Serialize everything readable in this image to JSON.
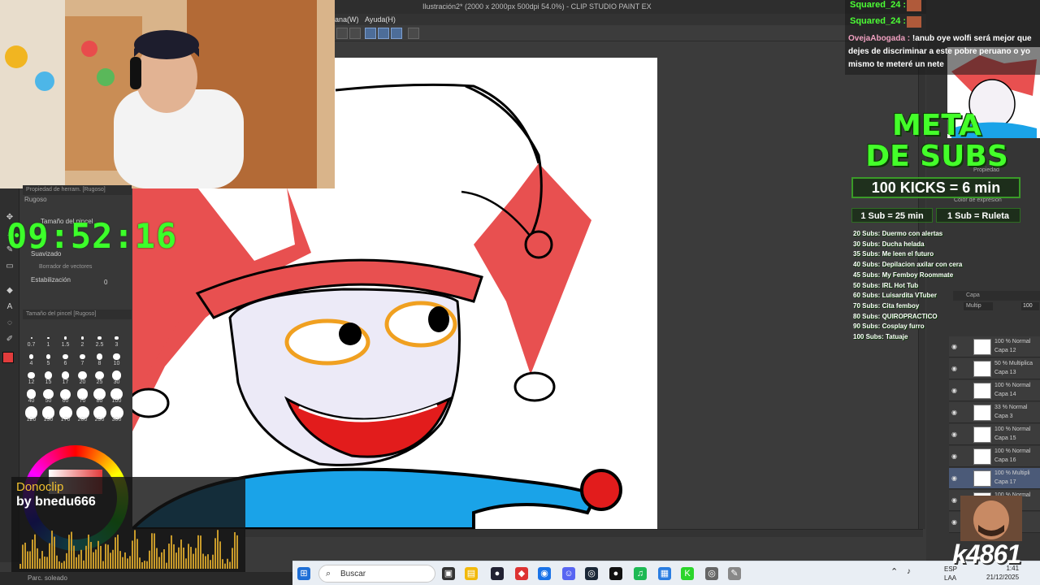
{
  "window": {
    "title": "Ilustración2* (2000 x 2000px 500dpi 54.0%) - CLIP STUDIO PAINT EX",
    "menu": [
      "ana(W)",
      "Ayuda(H)"
    ]
  },
  "timer": "09:52:16",
  "left_panel": {
    "brush_panel_title": "Propiedad de herram. [Rugoso]",
    "brush_name": "Rugoso",
    "brush_size_label": "Tamaño del pincel",
    "smoothing_label": "Suavizado",
    "vector_eraser_label": "Borrador de vectores",
    "stabilization_label": "Estabilización",
    "stabilization_value": "0",
    "size_panel_title": "Tamaño del pincel [Rugoso]",
    "sizes": [
      "0.7",
      "1",
      "1.5",
      "2",
      "2.5",
      "3",
      "4",
      "5",
      "6",
      "7",
      "8",
      "10",
      "12",
      "15",
      "17",
      "20",
      "25",
      "30",
      "40",
      "50",
      "60",
      "70",
      "80",
      "100",
      "120",
      "150",
      "170",
      "200",
      "250",
      "300"
    ]
  },
  "donoclip": {
    "title": "Donoclip",
    "by": "by bnedu666"
  },
  "chat": {
    "lines": [
      {
        "user": "Squared_24 :"
      },
      {
        "user": "Squared_24 :"
      }
    ],
    "message_user": "OvejaAbogada :",
    "message_text": "!anub oye wolfi será mejor que dejes de discriminar a este pobre peruano o yo mismo te meteré un nete"
  },
  "meta": {
    "line1": "META",
    "line2": "DE SUBS",
    "kicks": "100 KICKS = 6 min",
    "sub_rate": "1 Sub = 25 min",
    "sub_ruleta": "1 Sub = Ruleta",
    "goals": [
      "20 Subs: Duermo con alertas",
      "30 Subs: Ducha helada",
      "35 Subs: Me leen el futuro",
      "40 Subs: Depilacion axilar con cera",
      "45 Subs: My Femboy Roommate",
      "50 Subs: IRL Hot Tub",
      "60 Subs: Luisardita VTuber",
      "70 Subs: Cita femboy",
      "80 Subs: QUIROPRACTICO",
      "90 Subs: Cosplay furro",
      "100 Subs: Tatuaje"
    ]
  },
  "right_panel": {
    "property_label": "Propiedad",
    "color_expr_label": "Color de expresión",
    "layers_title": "Capa",
    "blend_mode": "Multip",
    "opacity": "100",
    "layers": [
      {
        "mode": "100 % Normal",
        "name": "Capa 12"
      },
      {
        "mode": "50 % Multiplica",
        "name": "Capa 13"
      },
      {
        "mode": "100 % Normal",
        "name": "Capa 14"
      },
      {
        "mode": "33 % Normal",
        "name": "Capa 3"
      },
      {
        "mode": "100 % Normal",
        "name": "Capa 15"
      },
      {
        "mode": "100 % Normal",
        "name": "Capa 16"
      },
      {
        "mode": "100 % Multipli",
        "name": "Capa 17"
      },
      {
        "mode": "100 % Normal",
        "name": ""
      },
      {
        "mode": "Normal",
        "name": ""
      }
    ]
  },
  "overlay_brand": "k4861",
  "statusbar": {
    "text": "Parc. soleado"
  },
  "taskbar": {
    "search_placeholder": "Buscar",
    "lang": "ESP",
    "lang2": "LAA",
    "time": "1:41",
    "date": "21/12/2025"
  },
  "colors": {
    "accent_green": "#3cff2a",
    "jester_red": "#e85050",
    "jester_blue": "#1aa3e8",
    "donoclip_gold": "#f0c030"
  }
}
